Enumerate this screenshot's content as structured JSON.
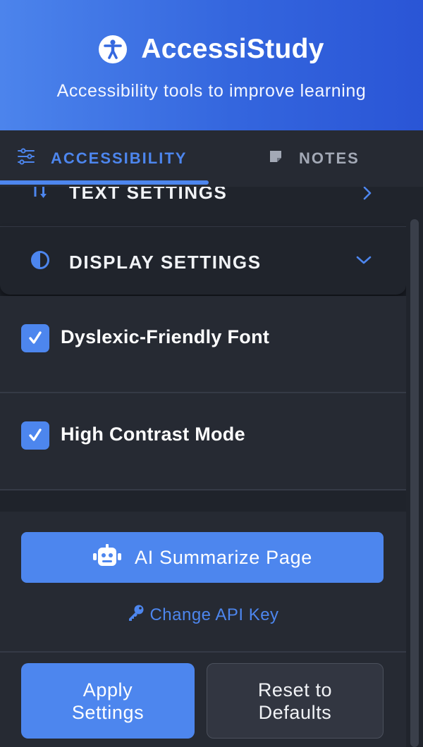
{
  "header": {
    "title": "AccessiStudy",
    "subtitle": "Accessibility tools to improve learning",
    "icon": "accessibility-person-icon"
  },
  "tabs": [
    {
      "label": "ACCESSIBILITY",
      "icon": "sliders-icon",
      "active": true
    },
    {
      "label": "NOTES",
      "icon": "sticky-note-icon",
      "active": false
    }
  ],
  "sections": {
    "text_settings": {
      "label": "TEXT SETTINGS",
      "icon": "text-size-icon",
      "expanded": false
    },
    "display_settings": {
      "label": "DISPLAY SETTINGS",
      "icon": "contrast-icon",
      "expanded": true
    }
  },
  "options": [
    {
      "label": "Dyslexic-Friendly Font",
      "checked": true
    },
    {
      "label": "High Contrast Mode",
      "checked": true
    }
  ],
  "ai": {
    "summarize_label": "AI Summarize Page",
    "change_api_label": "Change API Key"
  },
  "footer": {
    "apply_label": "Apply\nSettings",
    "reset_label": "Reset to\nDefaults"
  },
  "colors": {
    "accent": "#4d86ee",
    "header_gradient_start": "#4c84ec",
    "header_gradient_end": "#2a55d6",
    "panel": "#262a33",
    "background": "#1b1f27"
  }
}
